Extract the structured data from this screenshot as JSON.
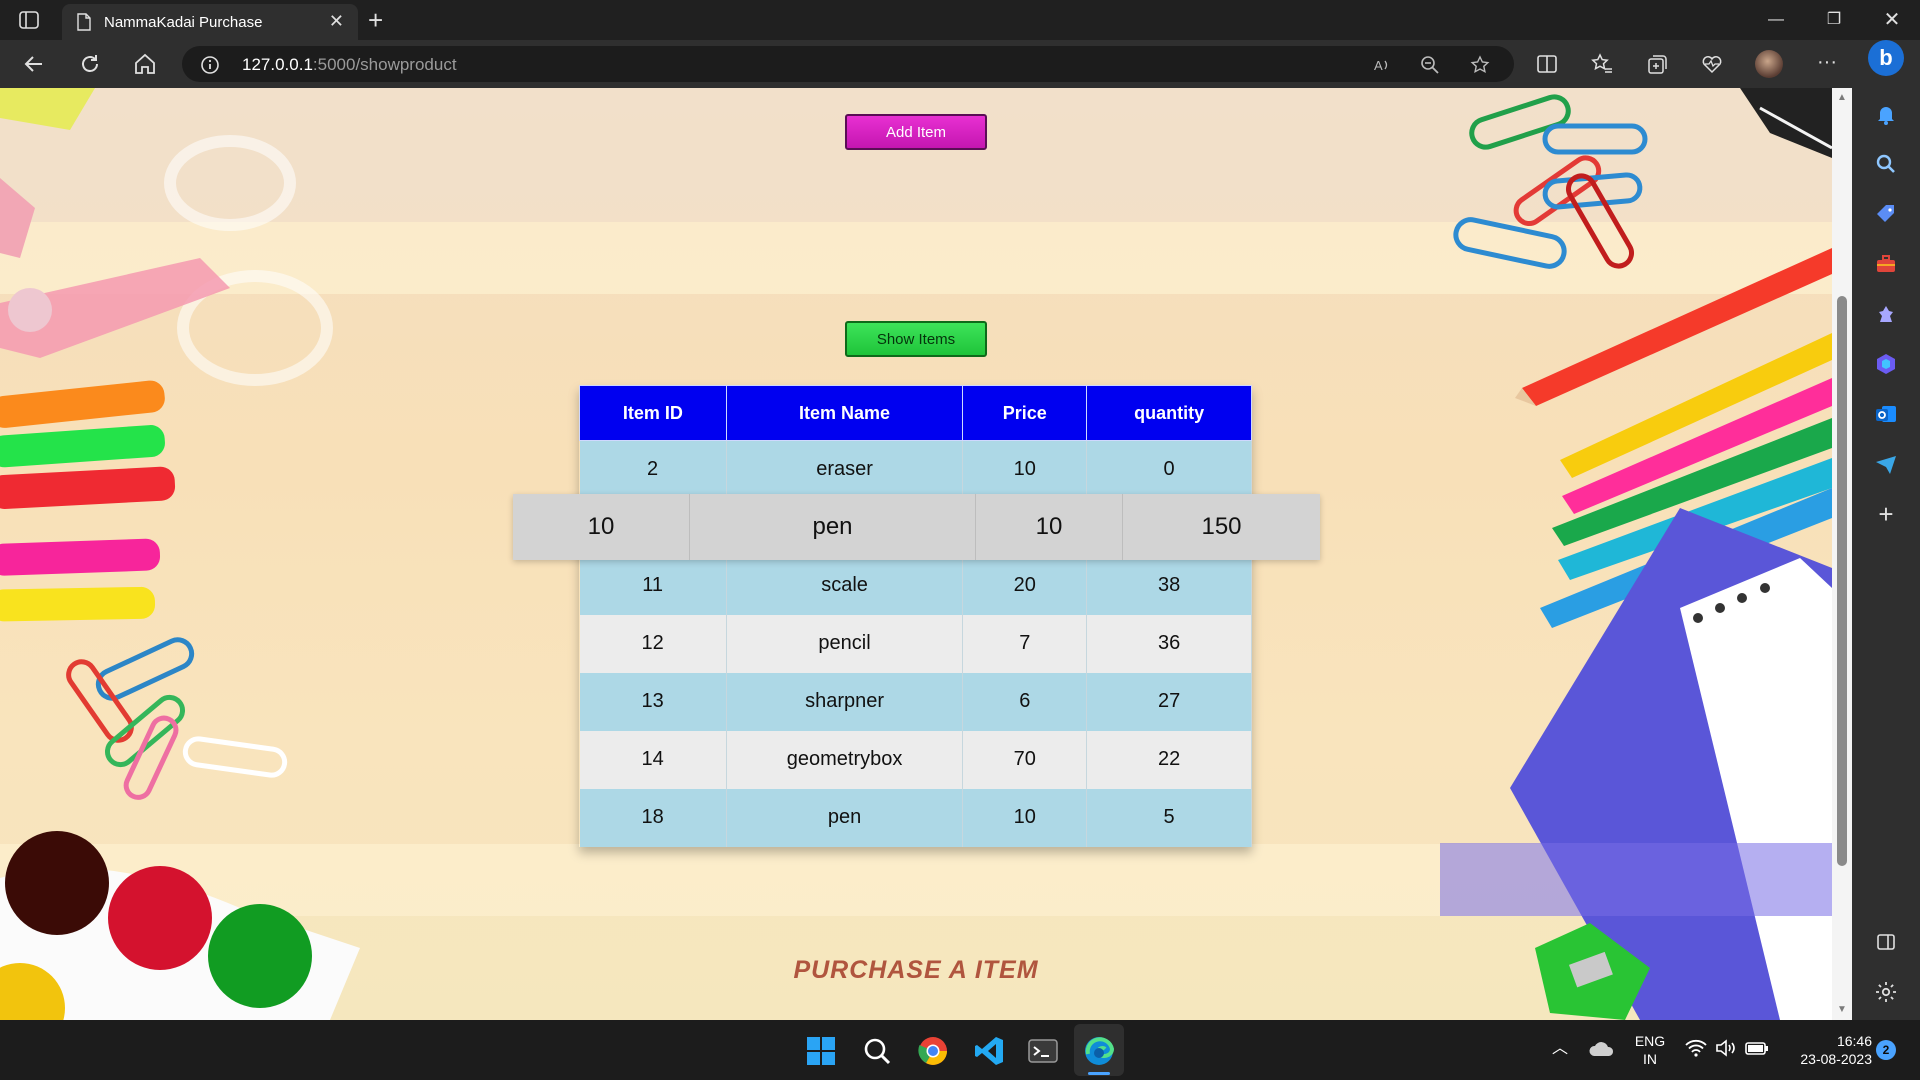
{
  "browser": {
    "tab_title": "NammaKadai Purchase",
    "url_host": "127.0.0.1",
    "url_path": ":5000/showproduct"
  },
  "page": {
    "add_button": "Add Item",
    "show_button": "Show Items",
    "footer_title": "PURCHASE A ITEM",
    "table": {
      "headers": [
        "Item ID",
        "Item Name",
        "Price",
        "quantity"
      ],
      "rows": [
        [
          "2",
          "eraser",
          "10",
          "0"
        ],
        [
          "10",
          "pen",
          "10",
          "150"
        ],
        [
          "11",
          "scale",
          "20",
          "38"
        ],
        [
          "12",
          "pencil",
          "7",
          "36"
        ],
        [
          "13",
          "sharpner",
          "6",
          "27"
        ],
        [
          "14",
          "geometrybox",
          "70",
          "22"
        ],
        [
          "18",
          "pen",
          "10",
          "5"
        ]
      ],
      "hovered_row_index": 1
    }
  },
  "taskbar": {
    "lang_primary": "ENG",
    "lang_secondary": "IN",
    "time": "16:46",
    "date": "23-08-2023",
    "notification_count": "2"
  },
  "colors": {
    "add_button": "#d21cbc",
    "show_button": "#2ad447",
    "table_header": "#0000f0",
    "row_odd": "#add8e6",
    "row_even": "#ececec",
    "footer_title": "#b0553e"
  }
}
